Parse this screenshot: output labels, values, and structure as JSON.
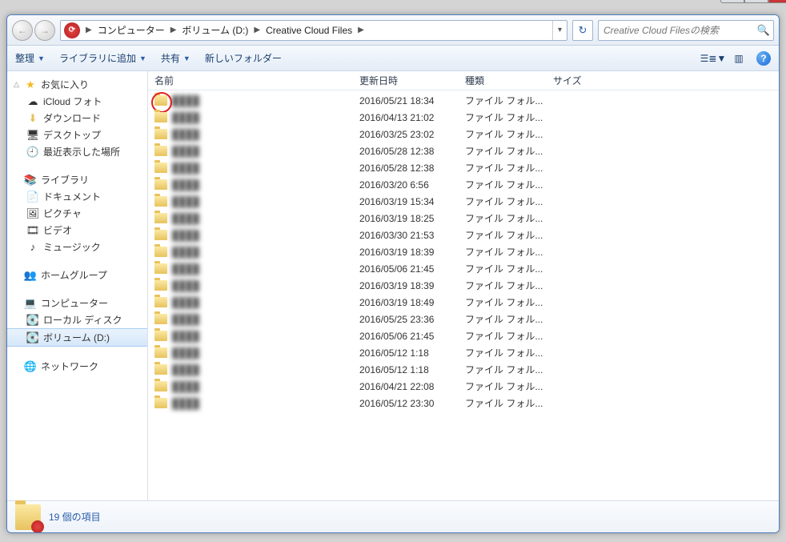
{
  "titlebar": {
    "min": "_",
    "max": "□",
    "close": "✕"
  },
  "nav": {
    "back": "←",
    "fwd": "→"
  },
  "breadcrumb": {
    "items": [
      "コンピューター",
      "ボリューム (D:)",
      "Creative Cloud Files"
    ],
    "dd": "▾"
  },
  "refresh": "↻",
  "search": {
    "placeholder": "Creative Cloud Filesの検索",
    "icon": "🔍"
  },
  "toolbar": {
    "organize": "整理",
    "library": "ライブラリに追加",
    "share": "共有",
    "newfolder": "新しいフォルダー",
    "dd": "▼",
    "view": "☰≣",
    "preview": "▥",
    "help": "?"
  },
  "sidebar": {
    "favorites": {
      "label": "お気に入り",
      "items": [
        "iCloud フォト",
        "ダウンロード",
        "デスクトップ",
        "最近表示した場所"
      ]
    },
    "libraries": {
      "label": "ライブラリ",
      "items": [
        "ドキュメント",
        "ピクチャ",
        "ビデオ",
        "ミュージック"
      ]
    },
    "homegroup": {
      "label": "ホームグループ"
    },
    "computer": {
      "label": "コンピューター",
      "items": [
        "ローカル ディスク",
        "ボリューム (D:)"
      ]
    },
    "network": {
      "label": "ネットワーク"
    }
  },
  "columns": {
    "name": "名前",
    "date": "更新日時",
    "type": "種類",
    "size": "サイズ"
  },
  "type_label": "ファイル フォル...",
  "rows": [
    {
      "date": "2016/05/21 18:34",
      "circled": true
    },
    {
      "date": "2016/04/13 21:02"
    },
    {
      "date": "2016/03/25 23:02"
    },
    {
      "date": "2016/05/28 12:38"
    },
    {
      "date": "2016/05/28 12:38"
    },
    {
      "date": "2016/03/20 6:56"
    },
    {
      "date": "2016/03/19 15:34"
    },
    {
      "date": "2016/03/19 18:25"
    },
    {
      "date": "2016/03/30 21:53"
    },
    {
      "date": "2016/03/19 18:39"
    },
    {
      "date": "2016/05/06 21:45"
    },
    {
      "date": "2016/03/19 18:39"
    },
    {
      "date": "2016/03/19 18:49"
    },
    {
      "date": "2016/05/25 23:36"
    },
    {
      "date": "2016/05/06 21:45"
    },
    {
      "date": "2016/05/12 1:18"
    },
    {
      "date": "2016/05/12 1:18"
    },
    {
      "date": "2016/04/21 22:08"
    },
    {
      "date": "2016/05/12 23:30"
    }
  ],
  "status": {
    "text": "19 個の項目"
  }
}
